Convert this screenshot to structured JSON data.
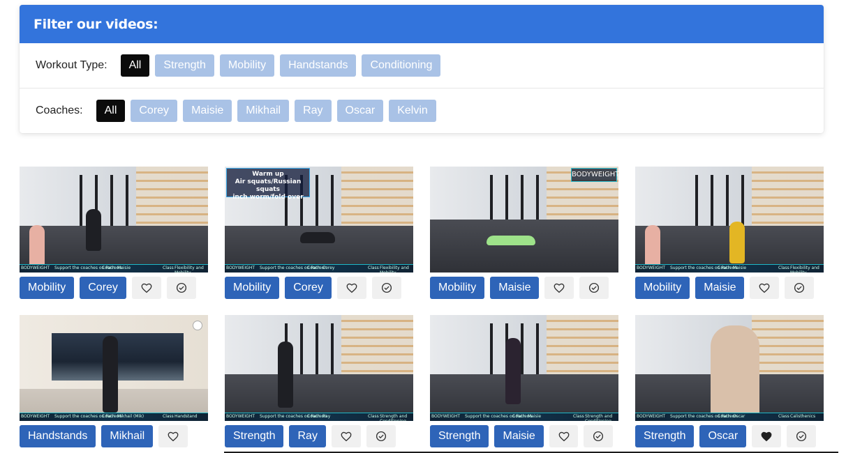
{
  "filter": {
    "title": "Filter our videos:",
    "workout_label": "Workout Type:",
    "workout_types": [
      {
        "label": "All",
        "active": true
      },
      {
        "label": "Strength",
        "active": false
      },
      {
        "label": "Mobility",
        "active": false
      },
      {
        "label": "Handstands",
        "active": false
      },
      {
        "label": "Conditioning",
        "active": false
      }
    ],
    "coaches_label": "Coaches:",
    "coaches": [
      {
        "label": "All",
        "active": true
      },
      {
        "label": "Corey",
        "active": false
      },
      {
        "label": "Maisie",
        "active": false
      },
      {
        "label": "Mikhail",
        "active": false
      },
      {
        "label": "Ray",
        "active": false
      },
      {
        "label": "Oscar",
        "active": false
      },
      {
        "label": "Kelvin",
        "active": false
      }
    ]
  },
  "videos": [
    {
      "type": "Mobility",
      "coach": "Corey",
      "liked": false,
      "has_check": true,
      "overlay": "",
      "lower_third": {
        "brand": "BODYWEIGHT",
        "support": "Support the coaches on Patreon",
        "coach_label": "Coach",
        "coach": "Maisie",
        "class_label": "Class",
        "class": "Flexibility and Mobility"
      }
    },
    {
      "type": "Mobility",
      "coach": "Corey",
      "liked": false,
      "has_check": true,
      "overlay": "Warm up\nAir squats/Russian squats\ninch worm/fold over",
      "lower_third": {
        "brand": "BODYWEIGHT",
        "support": "Support the coaches on Patreon",
        "coach_label": "Coach",
        "coach": "Corey",
        "class_label": "Class",
        "class": "Flexibility and Mobility"
      }
    },
    {
      "type": "Mobility",
      "coach": "Maisie",
      "liked": false,
      "has_check": true,
      "overlay": "BODYWEIGHT",
      "lower_third": null
    },
    {
      "type": "Mobility",
      "coach": "Maisie",
      "liked": false,
      "has_check": true,
      "overlay": "",
      "lower_third": {
        "brand": "BODYWEIGHT",
        "support": "Support the coaches on Patreon",
        "coach_label": "Coach",
        "coach": "Maisie",
        "class_label": "Class",
        "class": "Flexibility and Mobility"
      }
    },
    {
      "type": "Handstands",
      "coach": "Mikhail",
      "liked": false,
      "has_check": false,
      "overlay": "",
      "lower_third": {
        "brand": "BODYWEIGHT",
        "support": "Support the coaches on Patreon",
        "coach_label": "Coach",
        "coach": "Mikhail (Mik)",
        "class_label": "Class",
        "class": "Handstand"
      }
    },
    {
      "type": "Strength",
      "coach": "Ray",
      "liked": false,
      "has_check": true,
      "overlay": "",
      "lower_third": {
        "brand": "BODYWEIGHT",
        "support": "Support the coaches on Patreon",
        "coach_label": "Coach",
        "coach": "Ray",
        "class_label": "Class",
        "class": "Strength and Conditioning"
      }
    },
    {
      "type": "Strength",
      "coach": "Maisie",
      "liked": false,
      "has_check": true,
      "overlay": "",
      "lower_third": {
        "brand": "BODYWEIGHT",
        "support": "Support the coaches on Patreon",
        "coach_label": "Coach",
        "coach": "Maisie",
        "class_label": "Class",
        "class": "Strength and Conditioning"
      }
    },
    {
      "type": "Strength",
      "coach": "Oscar",
      "liked": true,
      "has_check": true,
      "overlay": "",
      "lower_third": {
        "brand": "BODYWEIGHT",
        "support": "Support the coaches on Patreon",
        "coach_label": "Coach",
        "coach": "Oscar",
        "class_label": "Class",
        "class": "Calisthenics"
      }
    }
  ],
  "colors": {
    "header_blue": "#3374dc",
    "chip_inactive": "#a9c2e6",
    "chip_active": "#0b0b0b",
    "tag_blue": "#2e64b8",
    "icon_button_bg": "#f0f0f0"
  },
  "icons": {
    "like": "heart-outline-icon",
    "liked": "heart-filled-icon",
    "complete": "check-circle-icon"
  }
}
